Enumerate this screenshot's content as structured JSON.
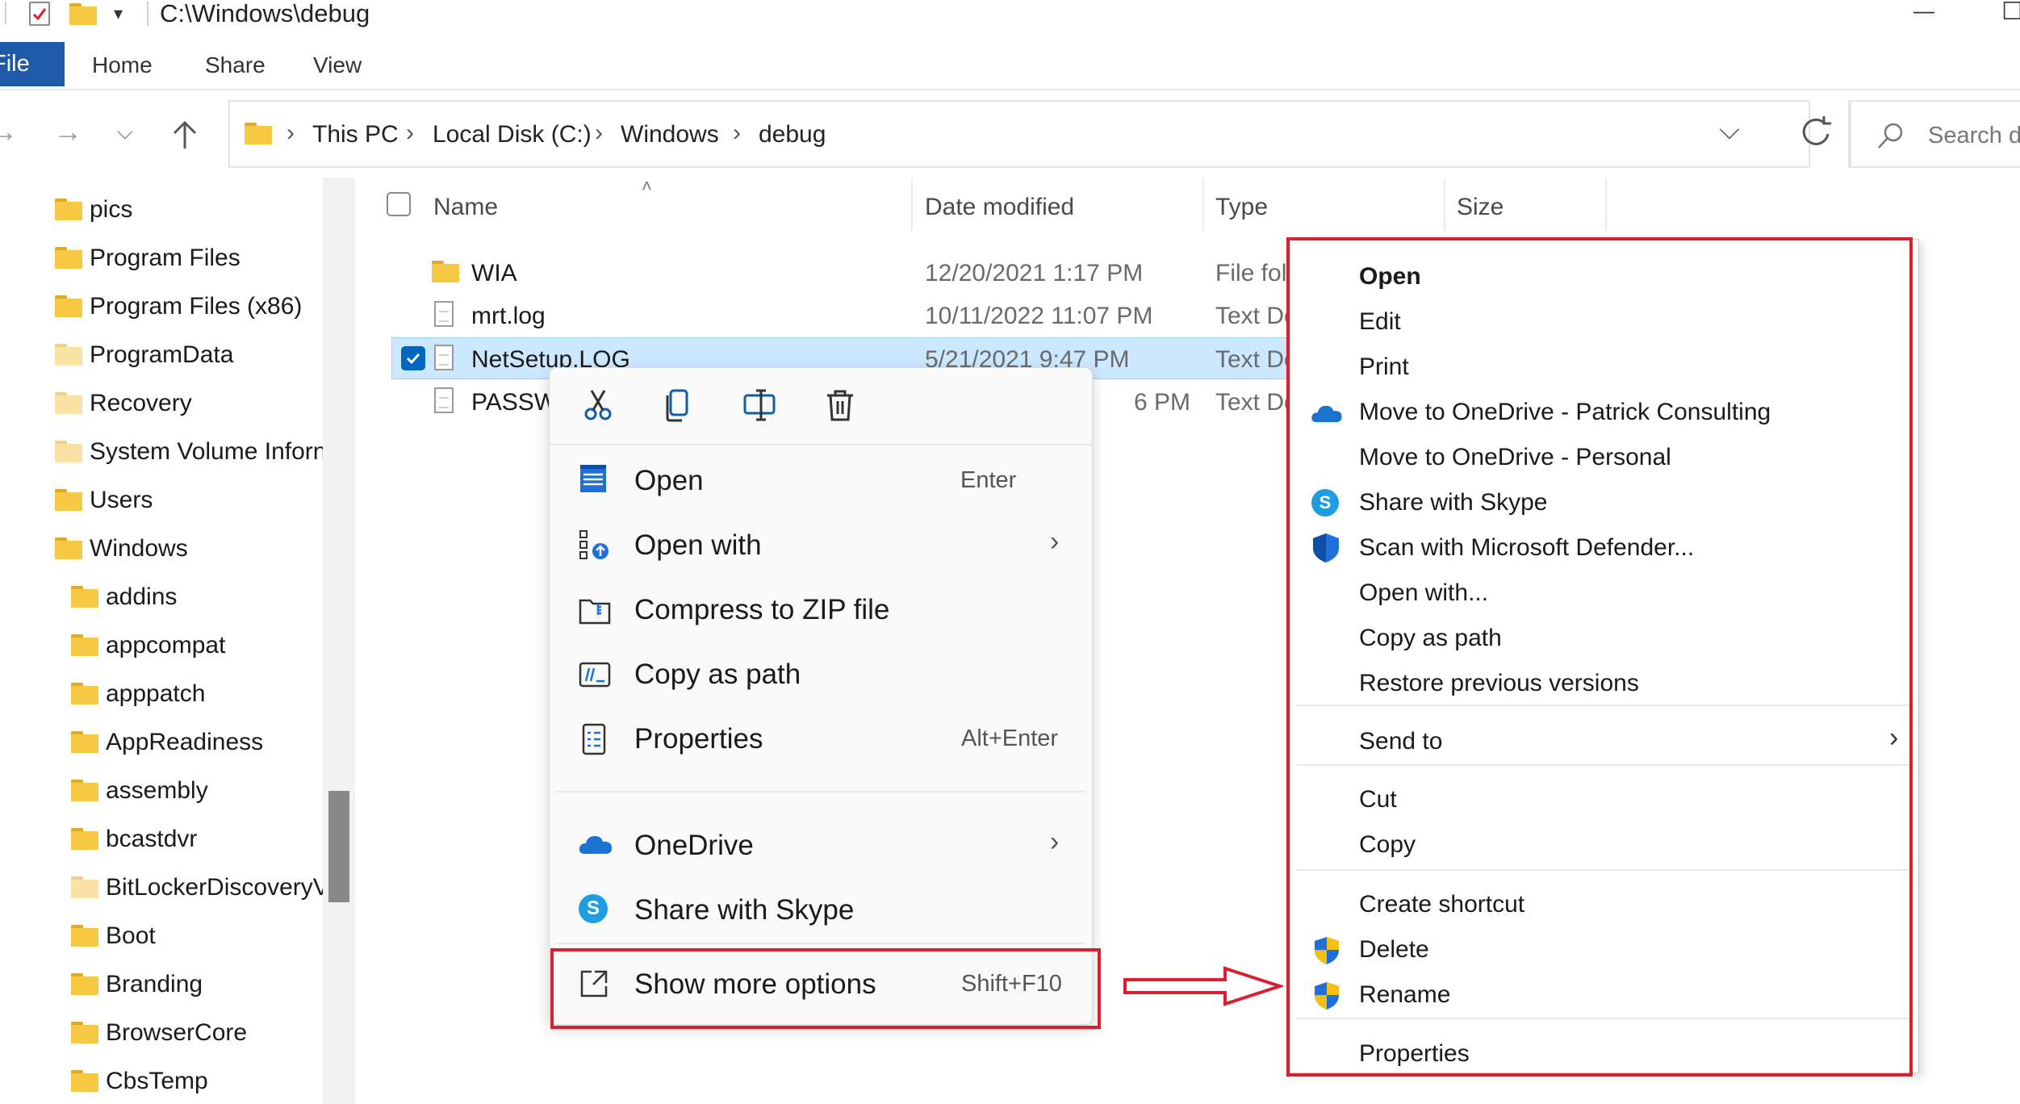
{
  "window": {
    "path_title": "C:\\Windows\\debug",
    "minimize_glyph": "—",
    "restore_glyph": "☐"
  },
  "ribbon": {
    "tabs": [
      {
        "label": "File"
      },
      {
        "label": "Home"
      },
      {
        "label": "Share"
      },
      {
        "label": "View"
      }
    ]
  },
  "address": {
    "crumbs": [
      "This PC",
      "Local Disk (C:)",
      "Windows",
      "debug"
    ],
    "search_placeholder": "Search d"
  },
  "tree": {
    "items": [
      {
        "label": "pics"
      },
      {
        "label": "Program Files"
      },
      {
        "label": "Program Files (x86)"
      },
      {
        "label": "ProgramData"
      },
      {
        "label": "Recovery"
      },
      {
        "label": "System Volume Inforn"
      },
      {
        "label": "Users"
      },
      {
        "label": "Windows"
      },
      {
        "label": "addins"
      },
      {
        "label": "appcompat"
      },
      {
        "label": "apppatch"
      },
      {
        "label": "AppReadiness"
      },
      {
        "label": "assembly"
      },
      {
        "label": "bcastdvr"
      },
      {
        "label": "BitLockerDiscoveryV"
      },
      {
        "label": "Boot"
      },
      {
        "label": "Branding"
      },
      {
        "label": "BrowserCore"
      },
      {
        "label": "CbsTemp"
      }
    ]
  },
  "file_list": {
    "columns": [
      "Name",
      "Date modified",
      "Type",
      "Size"
    ],
    "rows": [
      {
        "name": "WIA",
        "date": "12/20/2021 1:17 PM",
        "type": "File fol"
      },
      {
        "name": "mrt.log",
        "date": "10/11/2022 11:07 PM",
        "type": "Text Dc"
      },
      {
        "name": "NetSetup.LOG",
        "date": "5/21/2021 9:47 PM",
        "type": "Text Dc"
      },
      {
        "name": "PASSW",
        "date": "6 PM",
        "type": "Text Dc"
      }
    ]
  },
  "context_menu": {
    "items": [
      {
        "label": "Open",
        "shortcut": "Enter"
      },
      {
        "label": "Open with"
      },
      {
        "label": "Compress to ZIP file"
      },
      {
        "label": "Copy as path"
      },
      {
        "label": "Properties",
        "shortcut": "Alt+Enter"
      },
      {
        "label": "OneDrive"
      },
      {
        "label": "Share with Skype"
      },
      {
        "label": "Show more options",
        "shortcut": "Shift+F10"
      }
    ]
  },
  "classic_menu": {
    "items": [
      {
        "label": "Open"
      },
      {
        "label": "Edit"
      },
      {
        "label": "Print"
      },
      {
        "label": "Move to OneDrive - Patrick Consulting"
      },
      {
        "label": "Move to OneDrive - Personal"
      },
      {
        "label": "Share with Skype"
      },
      {
        "label": "Scan with Microsoft Defender..."
      },
      {
        "label": "Open with..."
      },
      {
        "label": "Copy as path"
      },
      {
        "label": "Restore previous versions"
      },
      {
        "label": "Send to"
      },
      {
        "label": "Cut"
      },
      {
        "label": "Copy"
      },
      {
        "label": "Create shortcut"
      },
      {
        "label": "Delete"
      },
      {
        "label": "Rename"
      },
      {
        "label": "Properties"
      }
    ]
  },
  "colors": {
    "annotation_red": "#d9202e",
    "selection_blue": "#cce8ff",
    "accent_blue": "#0067c0",
    "folder_yellow": "#f7c843"
  }
}
